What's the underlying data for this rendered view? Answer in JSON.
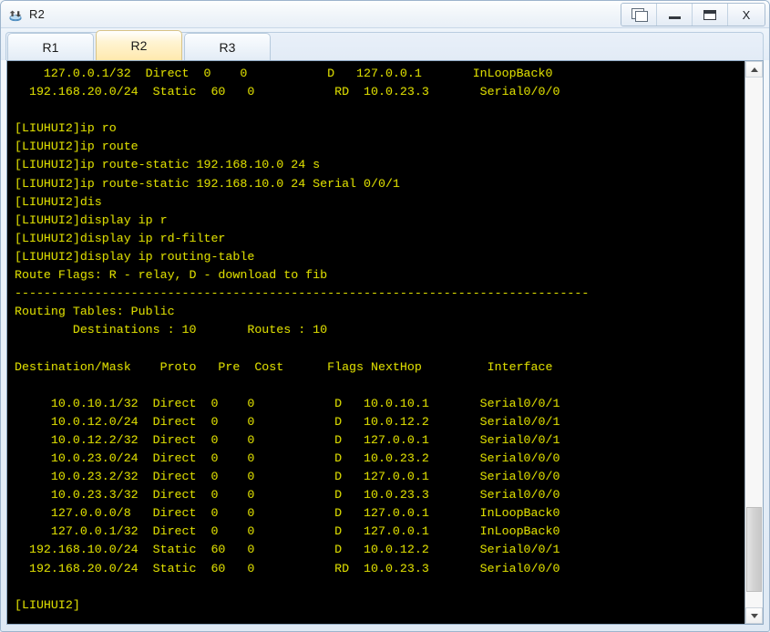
{
  "window": {
    "title": "R2",
    "icon": "router-icon",
    "controls": [
      {
        "name": "restore-windows-button",
        "icon": "restore-icon",
        "label": ""
      },
      {
        "name": "minimize-button",
        "icon": "minimize-icon",
        "label": ""
      },
      {
        "name": "maximize-button",
        "icon": "maximize-icon",
        "label": ""
      },
      {
        "name": "close-button",
        "icon": "close-icon",
        "label": "X"
      }
    ]
  },
  "tabs": [
    {
      "label": "R1",
      "active": false
    },
    {
      "label": "R2",
      "active": true
    },
    {
      "label": "R3",
      "active": false
    }
  ],
  "terminal": {
    "prompt": "[LIUHUI2]",
    "foreground_color": "#d9d900",
    "background_color": "#000000",
    "content": "    127.0.0.1/32  Direct  0    0           D   127.0.0.1       InLoopBack0\n  192.168.20.0/24  Static  60   0           RD  10.0.23.3       Serial0/0/0\n\n[LIUHUI2]ip ro\n[LIUHUI2]ip route\n[LIUHUI2]ip route-static 192.168.10.0 24 s\n[LIUHUI2]ip route-static 192.168.10.0 24 Serial 0/0/1\n[LIUHUI2]dis\n[LIUHUI2]display ip r\n[LIUHUI2]display ip rd-filter\n[LIUHUI2]display ip routing-table\nRoute Flags: R - relay, D - download to fib\n-------------------------------------------------------------------------------\nRouting Tables: Public\n        Destinations : 10       Routes : 10\n\nDestination/Mask    Proto   Pre  Cost      Flags NextHop         Interface\n\n     10.0.10.1/32  Direct  0    0           D   10.0.10.1       Serial0/0/1\n     10.0.12.0/24  Direct  0    0           D   10.0.12.2       Serial0/0/1\n     10.0.12.2/32  Direct  0    0           D   127.0.0.1       Serial0/0/1\n     10.0.23.0/24  Direct  0    0           D   10.0.23.2       Serial0/0/0\n     10.0.23.2/32  Direct  0    0           D   127.0.0.1       Serial0/0/0\n     10.0.23.3/32  Direct  0    0           D   10.0.23.3       Serial0/0/0\n     127.0.0.0/8   Direct  0    0           D   127.0.0.1       InLoopBack0\n     127.0.0.1/32  Direct  0    0           D   127.0.0.1       InLoopBack0\n  192.168.10.0/24  Static  60   0           D   10.0.12.2       Serial0/0/1\n  192.168.20.0/24  Static  60   0           RD  10.0.23.3       Serial0/0/0\n\n[LIUHUI2]",
    "routing_table": {
      "route_flags_legend": "Route Flags: R - relay, D - download to fib",
      "table_name": "Routing Tables: Public",
      "destinations": "10",
      "routes": "10",
      "columns": [
        "Destination/Mask",
        "Proto",
        "Pre",
        "Cost",
        "Flags",
        "NextHop",
        "Interface"
      ],
      "rows": [
        [
          "10.0.10.1/32",
          "Direct",
          "0",
          "0",
          "D",
          "10.0.10.1",
          "Serial0/0/1"
        ],
        [
          "10.0.12.0/24",
          "Direct",
          "0",
          "0",
          "D",
          "10.0.12.2",
          "Serial0/0/1"
        ],
        [
          "10.0.12.2/32",
          "Direct",
          "0",
          "0",
          "D",
          "127.0.0.1",
          "Serial0/0/1"
        ],
        [
          "10.0.23.0/24",
          "Direct",
          "0",
          "0",
          "D",
          "10.0.23.2",
          "Serial0/0/0"
        ],
        [
          "10.0.23.2/32",
          "Direct",
          "0",
          "0",
          "D",
          "127.0.0.1",
          "Serial0/0/0"
        ],
        [
          "10.0.23.3/32",
          "Direct",
          "0",
          "0",
          "D",
          "10.0.23.3",
          "Serial0/0/0"
        ],
        [
          "127.0.0.0/8",
          "Direct",
          "0",
          "0",
          "D",
          "127.0.0.1",
          "InLoopBack0"
        ],
        [
          "127.0.0.1/32",
          "Direct",
          "0",
          "0",
          "D",
          "127.0.0.1",
          "InLoopBack0"
        ],
        [
          "192.168.10.0/24",
          "Static",
          "60",
          "0",
          "D",
          "10.0.12.2",
          "Serial0/0/1"
        ],
        [
          "192.168.20.0/24",
          "Static",
          "60",
          "0",
          "RD",
          "10.0.23.3",
          "Serial0/0/0"
        ]
      ]
    },
    "commands": [
      "ip ro",
      "ip route",
      "ip route-static 192.168.10.0 24 s",
      "ip route-static 192.168.10.0 24 Serial 0/0/1",
      "dis",
      "display ip r",
      "display ip rd-filter",
      "display ip routing-table"
    ]
  },
  "scrollbar": {
    "up_arrow": "chevron-up-icon",
    "down_arrow": "chevron-down-icon"
  }
}
